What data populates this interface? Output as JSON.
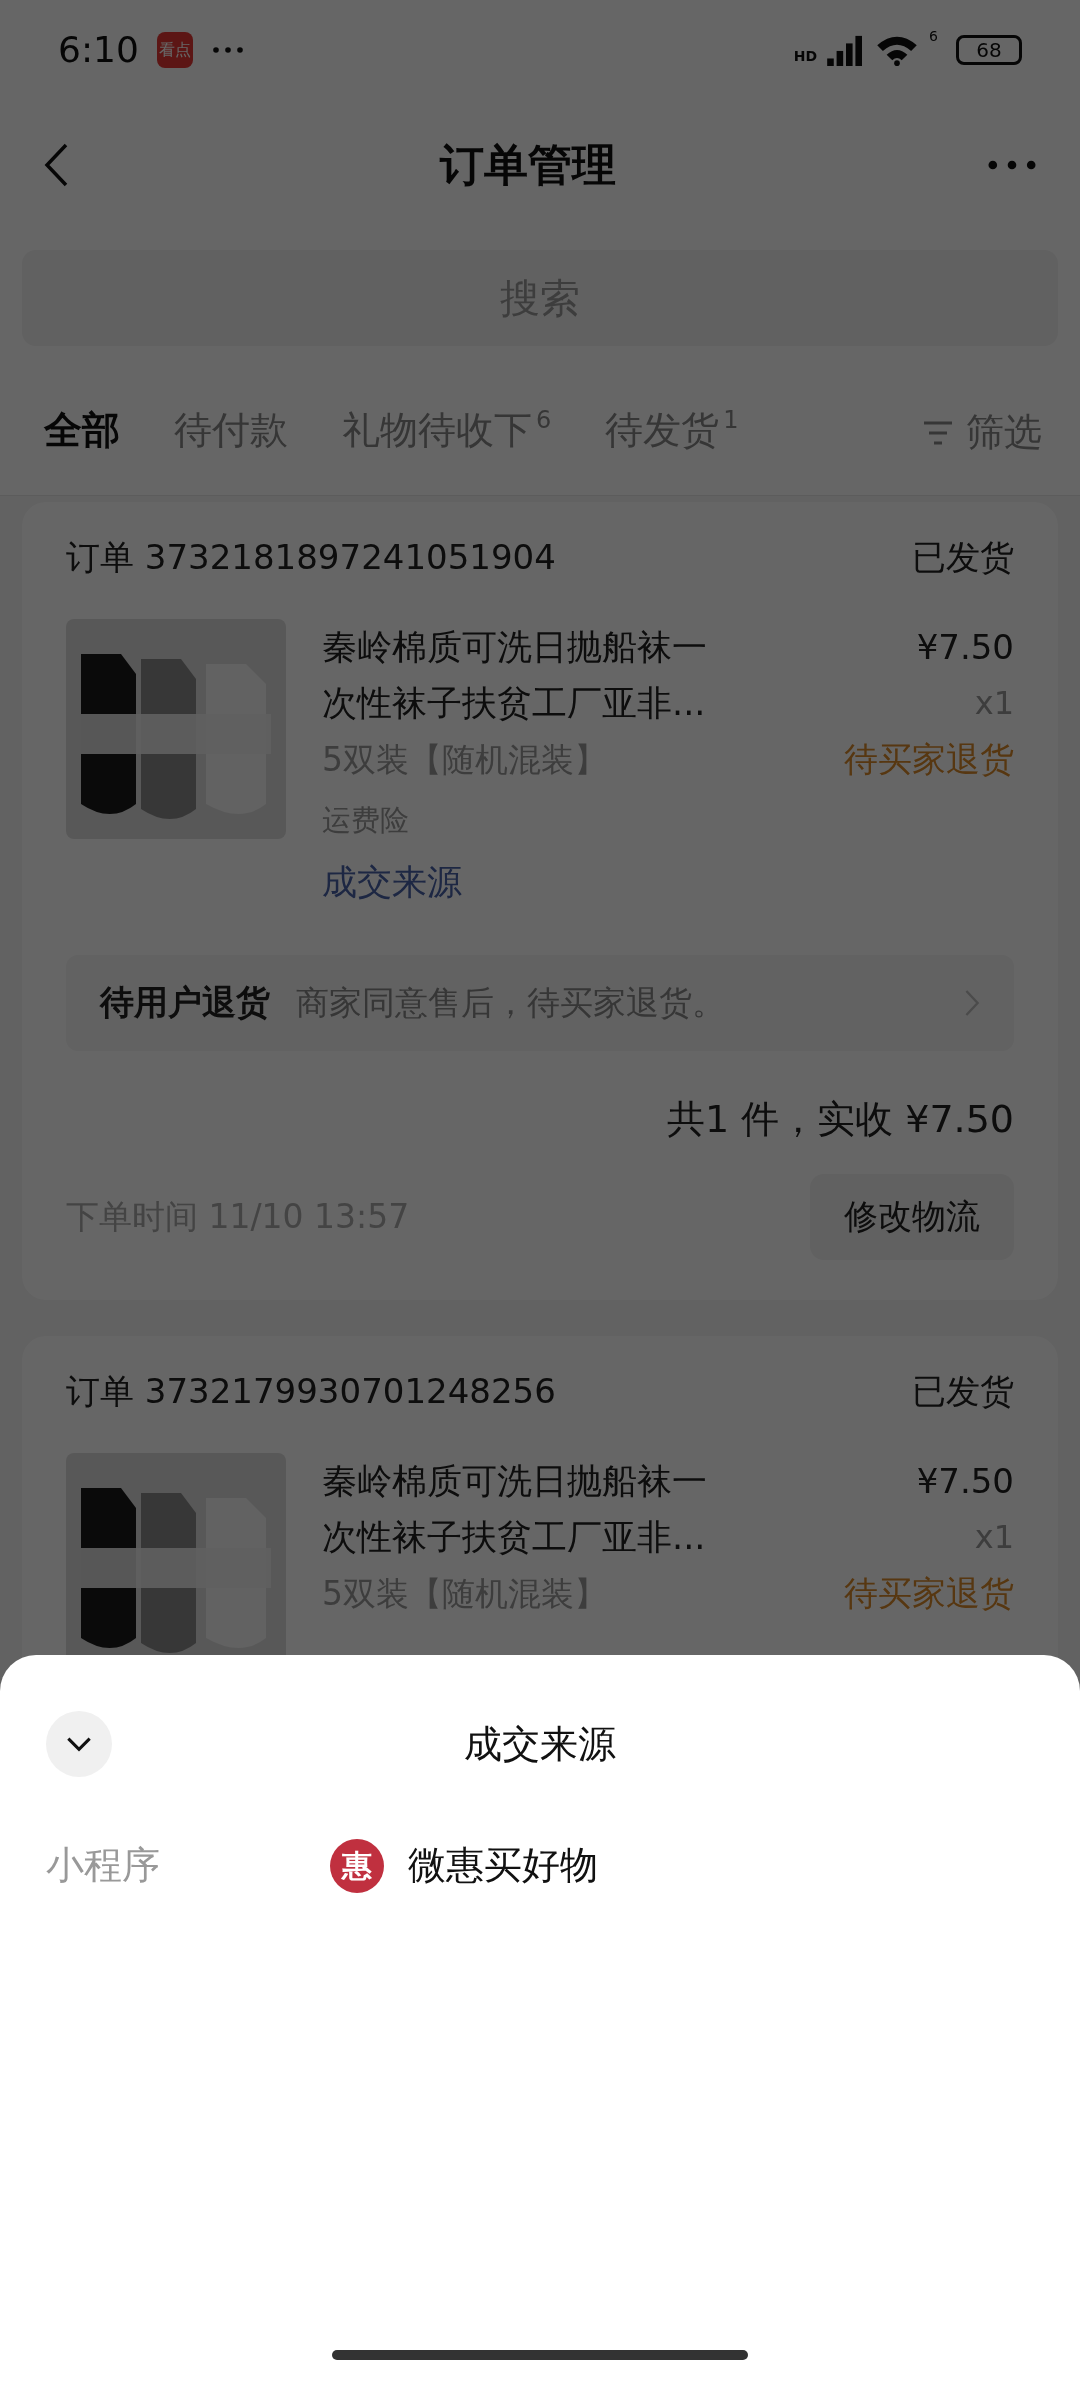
{
  "status_bar": {
    "time": "6:10",
    "app_icon_text": "看点",
    "network": "HD",
    "wifi_badge": "6",
    "battery": "68"
  },
  "nav": {
    "title": "订单管理"
  },
  "search": {
    "placeholder": "搜索"
  },
  "tabs": [
    {
      "label": "全部",
      "selected": true
    },
    {
      "label": "待付款",
      "selected": false
    },
    {
      "label": "礼物待收下",
      "count": "6",
      "selected": false
    },
    {
      "label": "待发货",
      "count": "1",
      "selected": false
    }
  ],
  "filter": {
    "label": "筛选"
  },
  "orders": [
    {
      "order_no": "订单 3732181897241051904",
      "status": "已发货",
      "product_title": "秦岭棉质可洗日抛船袜一次性袜子扶贫工厂亚非...",
      "sku": "5双装【随机混装】",
      "insurance": "运费险",
      "source_link": "成交来源",
      "price": "¥7.50",
      "qty": "x1",
      "after_sale": "待买家退货",
      "notice_title": "待用户退货",
      "notice_text": "商家同意售后，待买家退货。",
      "summary": "共1 件，实收 ¥7.50",
      "order_time": "下单时间 11/10 13:57",
      "action": "修改物流"
    },
    {
      "order_no": "订单 3732179930701248256",
      "status": "已发货",
      "product_title": "秦岭棉质可洗日抛船袜一次性袜子扶贫工厂亚非...",
      "sku": "5双装【随机混装】",
      "price": "¥7.50",
      "qty": "x1",
      "after_sale": "待买家退货"
    }
  ],
  "sheet": {
    "title": "成交来源",
    "rows": [
      {
        "label": "小程序",
        "icon_text": "惠",
        "value": "微惠买好物"
      }
    ]
  }
}
